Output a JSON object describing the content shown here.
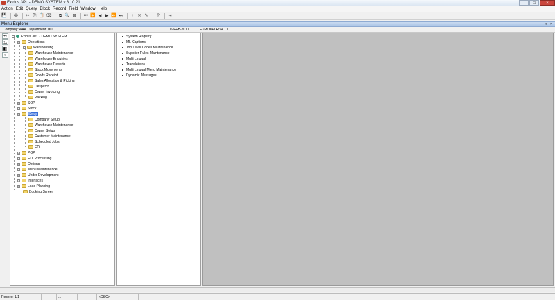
{
  "window": {
    "title": "Exidus 3PL - DEMO SYSTEM v.8.10.21",
    "minimize": "–",
    "maximize": "□",
    "close": "×"
  },
  "menu": [
    "Action",
    "Edit",
    "Query",
    "Block",
    "Record",
    "Field",
    "Window",
    "Help"
  ],
  "toolbar": {
    "icons": [
      "save-icon",
      "print-icon",
      "cut-icon",
      "copy-icon",
      "paste-icon",
      "clear-icon",
      "duplicate-icon",
      "query-icon",
      "find-icon",
      "first-icon",
      "prev-block-icon",
      "prev-icon",
      "next-icon",
      "next-block-icon",
      "last-icon",
      "insert-icon",
      "delete-icon",
      "lock-icon",
      "help-icon",
      "exit-icon"
    ],
    "glyphs": [
      "💾",
      "🖶",
      "✂",
      "⎘",
      "📋",
      "⌫",
      "⧉",
      "🔍",
      "⊞",
      "⏮",
      "⏪",
      "◀",
      "▶",
      "⏩",
      "⏭",
      "+",
      "✕",
      "✎",
      "?",
      "⇥"
    ]
  },
  "inner_window": {
    "title": "Menu Explorer"
  },
  "info": {
    "company_label": "Company: AAA",
    "department_label": "Department: 001",
    "date": "06-FEB-2017",
    "module": "FXMDXPLR v4.11"
  },
  "sidebar": {
    "glyphs": [
      "⇆",
      "⇆",
      "◧",
      "○"
    ]
  },
  "tree": {
    "root": "Exidus 3PL - DEMO SYSTEM",
    "nodes": [
      {
        "label": "Operations"
      },
      {
        "label": "Warehousing"
      },
      {
        "label": "Warehouse Maintenance"
      },
      {
        "label": "Warehouse Enquiries"
      },
      {
        "label": "Warehouse Reports"
      },
      {
        "label": "Stock Movements"
      },
      {
        "label": "Goods Receipt"
      },
      {
        "label": "Sales Allocation & Picking"
      },
      {
        "label": "Despatch"
      },
      {
        "label": "Owner Invoicing"
      },
      {
        "label": "Packing"
      },
      {
        "label": "SOP"
      },
      {
        "label": "Stock"
      },
      {
        "label": "Setup"
      },
      {
        "label": "Company Setup"
      },
      {
        "label": "Warehouse Maintenance"
      },
      {
        "label": "Owner Setup"
      },
      {
        "label": "Customer Maintenance"
      },
      {
        "label": "Scheduled Jobs"
      },
      {
        "label": "EDI"
      },
      {
        "label": "POP"
      },
      {
        "label": "EDI Processing"
      },
      {
        "label": "Options"
      },
      {
        "label": "Menu Maintenance"
      },
      {
        "label": "Under Development"
      },
      {
        "label": "Interfaces"
      },
      {
        "label": "Load Planning"
      },
      {
        "label": "Booking Screen"
      }
    ]
  },
  "list": {
    "items": [
      "System Registry",
      "ML Captions",
      "Top Level Codes Maintenance",
      "Supplier Rules Maintenance",
      "Multi Lingual",
      "Translations",
      "Multi Lingual Menu Maintenance",
      "Dynamic Messages"
    ]
  },
  "status": {
    "record": "Record: 1/1",
    "ellipsis": "...",
    "osc": "<OSC>"
  }
}
